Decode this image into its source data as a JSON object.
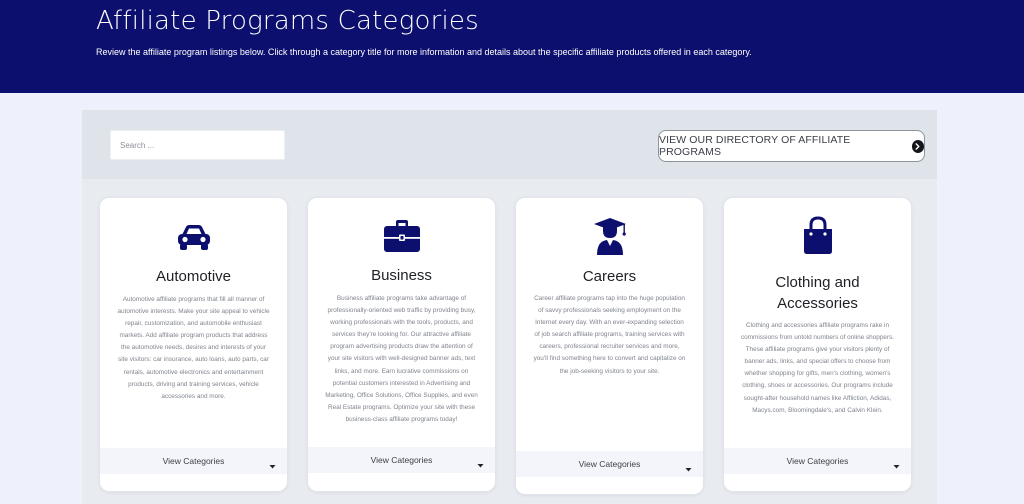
{
  "header": {
    "title": "Affiliate Programs Categories",
    "subtitle": "Review the affiliate program listings below. Click through a category title for more information and details about the specific affiliate products offered in each category."
  },
  "toolbar": {
    "search_placeholder": "Search ...",
    "directory_button_label": "VIEW OUR DIRECTORY OF AFFILIATE PROGRAMS"
  },
  "colors": {
    "header_bg": "#0c0f6e",
    "icon_color": "#0c0f6e",
    "page_bg": "#eef1fb"
  },
  "cards": [
    {
      "icon": "car-icon",
      "title": "Automotive",
      "description": "Automotive affiliate programs that fill all manner of automotive interests. Make your site appeal to vehicle repair, customization, and automobile enthusiast markets. Add affiliate program products that address the automotive needs, desires and interests of your site visitors: car insurance, auto loans, auto parts, car rentals, automotive electronics and entertainment products, driving and training services, vehicle accessories and more.",
      "footer_label": "View Categories"
    },
    {
      "icon": "briefcase-icon",
      "title": "Business",
      "description": "Business affiliate programs take advantage of professionally-oriented web traffic by providing busy, working professionals with the tools, products, and services they're looking for. Our attractive affiliate program advertising products draw the attention of your site visitors with well-designed banner ads, text links, and more. Earn lucrative commissions on potential customers interested in Advertising and Marketing, Office Solutions, Office Supplies, and even Real Estate programs. Optimize your site with these business-class affiliate programs today!",
      "footer_label": "View Categories"
    },
    {
      "icon": "graduate-icon",
      "title": "Careers",
      "description": "Career affiliate programs tap into the huge population of savvy professionals seeking employment on the Internet every day. With an ever-expanding selection of job search affiliate programs, training services with careers, professional recruiter services and more, you'll find something here to convert and capitalize on the job-seeking visitors to your site.",
      "footer_label": "View Categories"
    },
    {
      "icon": "shopping-bag-icon",
      "title": "Clothing and Accessories",
      "description": "Clothing and accessories affiliate programs rake in commissions from untold numbers of online shoppers. These affiliate programs give your visitors plenty of banner ads, links, and special offers to choose from whether shopping for gifts, men's clothing, women's clothing, shoes or accessories. Our programs include sought-after household names like Affliction, Adidas, Macys.com, Bloomingdale's, and Calvin Klein.",
      "footer_label": "View Categories"
    }
  ]
}
